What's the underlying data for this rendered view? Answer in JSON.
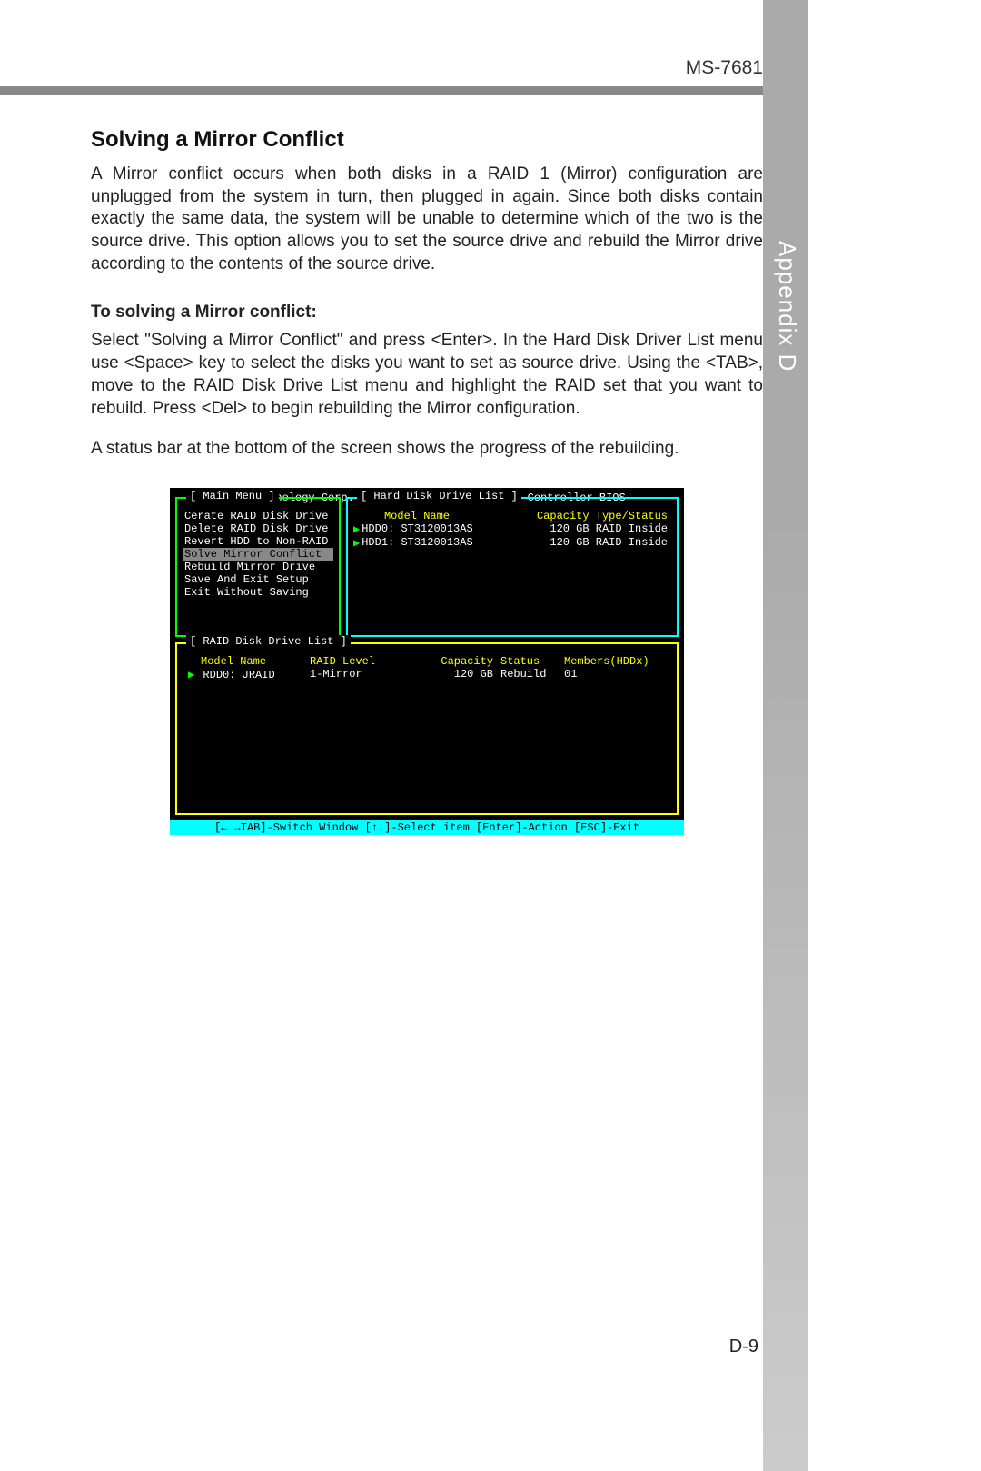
{
  "header": {
    "doc_code": "MS-7681",
    "side_label": "Appendix D",
    "page_num": "D-9"
  },
  "section": {
    "title": "Solving a Mirror Conflict",
    "para1": "A Mirror conflict occurs when both disks in a RAID 1 (Mirror) configuration are unplugged from the system in turn, then plugged in again. Since both disks contain exactly the same data, the system will be unable to determine which of the two is the source drive. This option allows you to set the source drive and rebuild the Mirror drive according to the contents of the source drive.",
    "sub_heading": "To solving a Mirror conflict:",
    "para2": "Select \"Solving a Mirror Conflict\" and press <Enter>. In the Hard Disk Driver List menu use <Space> key to select the disks you want to set as source drive. Using the <TAB>, move to the RAID Disk Drive List menu and highlight the RAID set that you want to rebuild. Press <Del> to begin rebuilding the Mirror configuration.",
    "para3": "A status bar at the bottom of the screen shows the progress of the rebuilding."
  },
  "bios": {
    "title_left": "JMicron Technology Corp.",
    "title_right": "PCIE-to-SATAII/IDE RAID Controller BIOS",
    "main_menu": {
      "legend": "[ Main Menu ]",
      "items": [
        "Cerate RAID Disk Drive",
        "Delete RAID Disk Drive",
        "Revert HDD to Non-RAID",
        "Solve Mirror Conflict",
        "Rebuild Mirror Drive",
        "Save And Exit Setup",
        "Exit Without Saving"
      ],
      "selected_index": 3
    },
    "hdd_list": {
      "legend": "[ Hard Disk Drive List ]",
      "col_model": "Model Name",
      "col_cap": "Capacity Type/Status",
      "rows": [
        {
          "model": "HDD0: ST3120013AS",
          "cap": "120 GB RAID Inside"
        },
        {
          "model": "HDD1: ST3120013AS",
          "cap": "120 GB RAID Inside"
        }
      ]
    },
    "raid_list": {
      "legend": "[ RAID Disk Drive List ]",
      "cols": {
        "model": "Model Name",
        "level": "RAID Level",
        "capacity": "Capacity",
        "status": "Status",
        "members": "Members(HDDx)"
      },
      "rows": [
        {
          "model": "RDD0: JRAID",
          "level": "1-Mirror",
          "capacity": "120 GB",
          "status": "Rebuild",
          "members": "01"
        }
      ]
    },
    "footer": "[← →TAB]-Switch Window [↑↓]-Select item [Enter]-Action [ESC]-Exit"
  }
}
